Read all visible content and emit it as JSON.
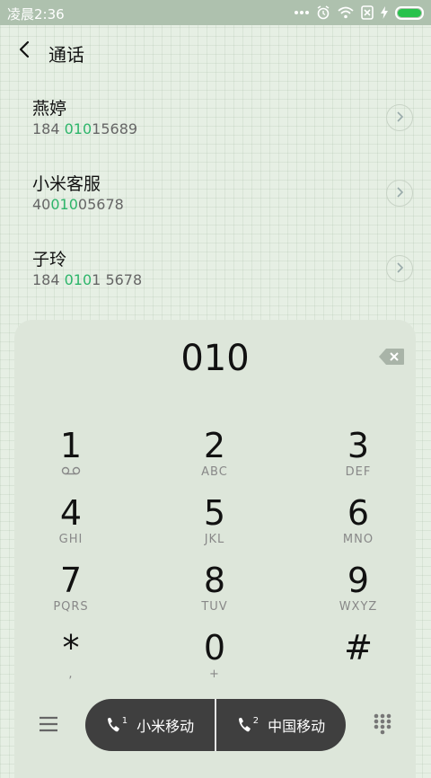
{
  "status_bar": {
    "time": "凌晨2:36",
    "icons": [
      "more-dots-icon",
      "alarm-icon",
      "wifi-icon",
      "sim-blocked-icon",
      "charging-icon",
      "battery-icon"
    ],
    "battery_color": "#27c24c",
    "battery_level": 1.0
  },
  "header": {
    "back_icon": "back-arrow-icon",
    "title": "通话"
  },
  "contacts": [
    {
      "name": "燕婷",
      "number_pre": "184 ",
      "number_hl": "010",
      "number_post": "15689"
    },
    {
      "name": "小米客服",
      "number_pre": "40",
      "number_hl": "010",
      "number_post": "05678"
    },
    {
      "name": "子玲",
      "number_pre": "184 ",
      "number_hl": "010",
      "number_post": "1 5678"
    }
  ],
  "highlight_color": "#2db56a",
  "dialpad": {
    "entered": "010",
    "keys": [
      {
        "digit": "1",
        "sub": "voicemail-icon"
      },
      {
        "digit": "2",
        "sub": "ABC"
      },
      {
        "digit": "3",
        "sub": "DEF"
      },
      {
        "digit": "4",
        "sub": "GHI"
      },
      {
        "digit": "5",
        "sub": "JKL"
      },
      {
        "digit": "6",
        "sub": "MNO"
      },
      {
        "digit": "7",
        "sub": "PQRS"
      },
      {
        "digit": "8",
        "sub": "TUV"
      },
      {
        "digit": "9",
        "sub": "WXYZ"
      },
      {
        "digit": "*",
        "sub": ","
      },
      {
        "digit": "0",
        "sub": "+"
      },
      {
        "digit": "#",
        "sub": ""
      }
    ]
  },
  "bottom_bar": {
    "sim1_label": "小米移动",
    "sim2_label": "中国移动",
    "sim1_badge": "1",
    "sim2_badge": "2"
  }
}
